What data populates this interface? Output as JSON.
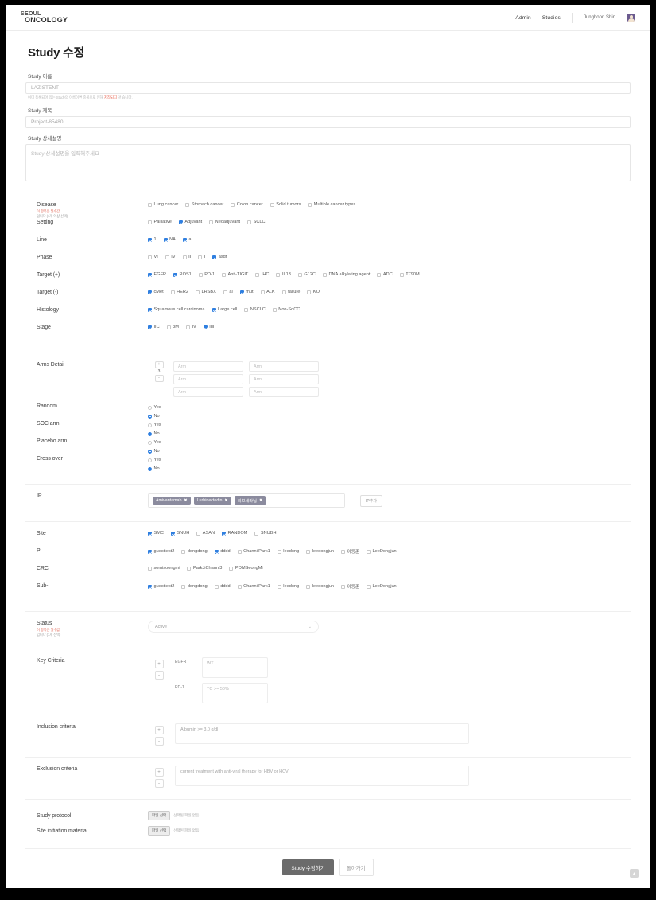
{
  "navbar": {
    "logo_top": "SEOUL",
    "logo_bottom": "ONCOLOGY",
    "links": [
      {
        "label": "Admin"
      },
      {
        "label": "Studies"
      }
    ],
    "user_name": "Junghoon Shin"
  },
  "page": {
    "title": "Study 수정"
  },
  "form": {
    "study_name_label": "Study 이름",
    "study_name_value": "LAZISTENT",
    "study_name_helper_pre": "이미 등록되어 있는 Study의 이름이면 중복으로 인해 ",
    "study_name_helper_hl": "저장되지",
    "study_name_helper_post": " 않 습니다.",
    "study_title_label": "Study 제목",
    "study_title_value": "Project-85480",
    "study_desc_label": "Study 상세설명",
    "study_desc_placeholder": "Study 상세설명을 입력해주세요"
  },
  "criteria": {
    "disease": {
      "label": "Disease",
      "sub": "이 항목은 필수값",
      "sub2": "입니다 (1개 이상 선택)",
      "options": [
        {
          "label": "Lung cancer",
          "checked": false
        },
        {
          "label": "Stomach cancer",
          "checked": false
        },
        {
          "label": "Colon cancer",
          "checked": false
        },
        {
          "label": "Solid tumors",
          "checked": false
        },
        {
          "label": "Multiple cancer types",
          "checked": false
        }
      ]
    },
    "setting": {
      "label": "Setting",
      "options": [
        {
          "label": "Palliative",
          "checked": false
        },
        {
          "label": "Adjuvant",
          "checked": true
        },
        {
          "label": "Neoadjuvant",
          "checked": false
        },
        {
          "label": "SCLC",
          "checked": false
        }
      ]
    },
    "line": {
      "label": "Line",
      "options": [
        {
          "label": "1",
          "checked": true
        },
        {
          "label": "NA",
          "checked": true
        },
        {
          "label": "a",
          "checked": true
        }
      ]
    },
    "phase": {
      "label": "Phase",
      "options": [
        {
          "label": "VI",
          "checked": false
        },
        {
          "label": "IV",
          "checked": false
        },
        {
          "label": "II",
          "checked": false
        },
        {
          "label": "I",
          "checked": false
        },
        {
          "label": "asdf",
          "checked": true
        }
      ]
    },
    "target_pos": {
      "label": "Target (+)",
      "options": [
        {
          "label": "EGFR",
          "checked": true
        },
        {
          "label": "ROS1",
          "checked": true
        },
        {
          "label": "PD-1",
          "checked": false
        },
        {
          "label": "Anti-TIGIT",
          "checked": false
        },
        {
          "label": "IHC",
          "checked": false
        },
        {
          "label": "IL13",
          "checked": false
        },
        {
          "label": "G12C",
          "checked": false
        },
        {
          "label": "DNA alkylating agent",
          "checked": false
        },
        {
          "label": "ADC",
          "checked": false
        },
        {
          "label": "T790M",
          "checked": false
        }
      ]
    },
    "target_neg": {
      "label": "Target (-)",
      "options": [
        {
          "label": "cMet",
          "checked": true
        },
        {
          "label": "HER2",
          "checked": false
        },
        {
          "label": "LRSBX",
          "checked": false
        },
        {
          "label": "al",
          "checked": false
        },
        {
          "label": "mut",
          "checked": true
        },
        {
          "label": "ALK",
          "checked": false
        },
        {
          "label": "failure",
          "checked": false
        },
        {
          "label": "KO",
          "checked": false
        }
      ]
    },
    "histology": {
      "label": "Histology",
      "options": [
        {
          "label": "Squamous cell carcinoma",
          "checked": true
        },
        {
          "label": "Large cell",
          "checked": true
        },
        {
          "label": "NSCLC",
          "checked": false
        },
        {
          "label": "Non-SqCC",
          "checked": false
        }
      ]
    },
    "stage": {
      "label": "Stage",
      "options": [
        {
          "label": "IIC",
          "checked": true
        },
        {
          "label": "3M",
          "checked": false
        },
        {
          "label": "IV",
          "checked": false
        },
        {
          "label": "IIIII",
          "checked": true
        }
      ]
    }
  },
  "arms": {
    "label": "Arms Detail",
    "count": "3",
    "plus": "+",
    "minus": "-",
    "inputs": [
      {
        "placeholder": "Arm"
      },
      {
        "placeholder": "Arm"
      },
      {
        "placeholder": "Arm"
      },
      {
        "placeholder": "Arm"
      },
      {
        "placeholder": "Arm"
      },
      {
        "placeholder": "Arm"
      }
    ]
  },
  "yesno": {
    "yes": "Yes",
    "no": "No",
    "random": {
      "label": "Random",
      "value": "No"
    },
    "soc_arm": {
      "label": "SOC arm",
      "value": "No"
    },
    "placebo_arm": {
      "label": "Placebo arm",
      "value": "No"
    },
    "cross_over": {
      "label": "Cross over",
      "value": "No"
    }
  },
  "ip": {
    "label": "IP",
    "tags": [
      {
        "label": "Amivantamab"
      },
      {
        "label": "Lurbinectedin"
      },
      {
        "label": "리보세라닙"
      }
    ],
    "add_label": "IP추가"
  },
  "sites": {
    "site": {
      "label": "Site",
      "options": [
        {
          "label": "SMC",
          "checked": true
        },
        {
          "label": "SNUH",
          "checked": true
        },
        {
          "label": "ASAN",
          "checked": false
        },
        {
          "label": "RANDOM",
          "checked": true
        },
        {
          "label": "SNUBH",
          "checked": false
        }
      ]
    },
    "pi": {
      "label": "PI",
      "options": [
        {
          "label": "guesttest2",
          "checked": true
        },
        {
          "label": "dongdong",
          "checked": false
        },
        {
          "label": "dddd",
          "checked": true
        },
        {
          "label": "ChannilPark1",
          "checked": false
        },
        {
          "label": "leedong",
          "checked": false
        },
        {
          "label": "leedongjun",
          "checked": false
        },
        {
          "label": "이동준",
          "checked": false
        },
        {
          "label": "LeeDongjun",
          "checked": false
        }
      ]
    },
    "crc": {
      "label": "CRC",
      "options": [
        {
          "label": "somisoongmi",
          "checked": false
        },
        {
          "label": "ParkJiChanni3",
          "checked": false
        },
        {
          "label": "POMSeongMi",
          "checked": false
        }
      ]
    },
    "sub_i": {
      "label": "Sub-I",
      "options": [
        {
          "label": "guesttest2",
          "checked": true
        },
        {
          "label": "dongdong",
          "checked": false
        },
        {
          "label": "dddd",
          "checked": false
        },
        {
          "label": "ChannilPark1",
          "checked": false
        },
        {
          "label": "leedong",
          "checked": false
        },
        {
          "label": "leedongjun",
          "checked": false
        },
        {
          "label": "이동준",
          "checked": false
        },
        {
          "label": "LeeDongjun",
          "checked": false
        }
      ]
    }
  },
  "status": {
    "label": "Status",
    "sub": "이 항목은 필수값",
    "sub2": "입니다 (1개 선택)",
    "value": "Active",
    "caret": "⌄"
  },
  "key_criteria": {
    "label": "Key Criteria",
    "plus": "+",
    "minus": "-",
    "items": [
      {
        "key": "EGFR",
        "value": "WT"
      },
      {
        "key": "PD-1",
        "value": "TC >= 50%"
      }
    ]
  },
  "inclusion": {
    "label": "Inclusion criteria",
    "plus": "+",
    "minus": "-",
    "value": "Albumin >= 3.0 g/dl"
  },
  "exclusion": {
    "label": "Exclusion criteria",
    "plus": "+",
    "minus": "-",
    "value": "current treatment with anti-viral therapy for HBV or HCV"
  },
  "files": {
    "protocol": {
      "label": "Study protocol",
      "button": "파일 선택",
      "note": "선택된 파일 없음"
    },
    "site_init": {
      "label": "Site initiation material",
      "button": "파일 선택",
      "note": "선택된 파일 없음"
    }
  },
  "footer": {
    "submit": "Study 수정하기",
    "back": "돌아가기",
    "scroll_top": "▲"
  }
}
